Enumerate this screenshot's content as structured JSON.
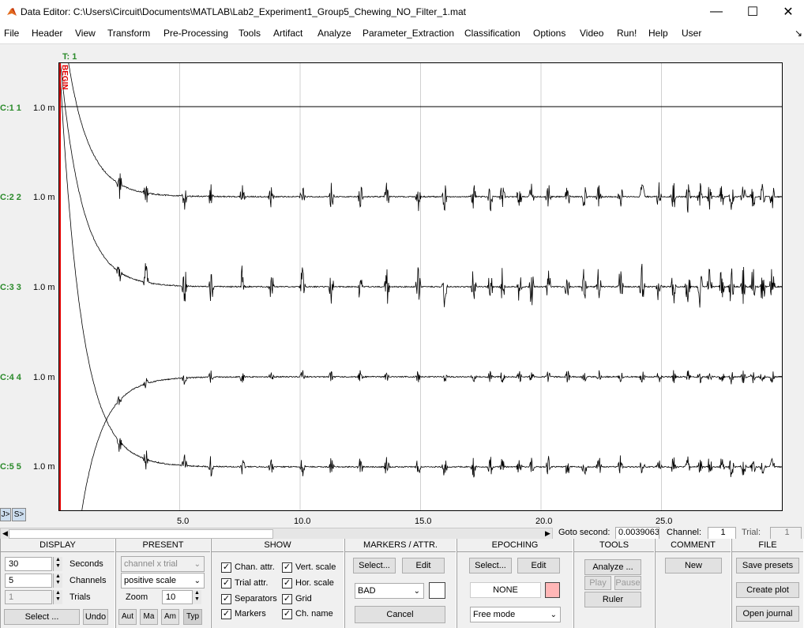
{
  "window": {
    "title": "Data Editor: C:\\Users\\Circuit\\Documents\\MATLAB\\Lab2_Experiment1_Group5_Chewing_NO_Filter_1.mat",
    "minimize": "—",
    "maximize": "☐",
    "close": "✕"
  },
  "menu": [
    "File",
    "Header",
    "View",
    "Transform",
    "Pre-Processing",
    "Tools",
    "Artifact",
    "Analyze",
    "Parameter_Extraction",
    "Classification",
    "Options",
    "Video",
    "Run!",
    "Help",
    "User"
  ],
  "menu_right_glyph": "↘",
  "plot": {
    "trial_label": "T: 1",
    "begin_marker": "BEGIN",
    "channels": [
      {
        "label": "C:1 1",
        "scale": "1.0 m"
      },
      {
        "label": "C:2 2",
        "scale": "1.0 m"
      },
      {
        "label": "C:3 3",
        "scale": "1.0 m"
      },
      {
        "label": "C:4 4",
        "scale": "1.0 m"
      },
      {
        "label": "C:5 5",
        "scale": "1.0 m"
      }
    ],
    "x_ticks": [
      "5.0",
      "10.0",
      "15.0",
      "20.0",
      "25.0"
    ],
    "colors": {
      "marker": "#e00000",
      "label": "#2a8a2a",
      "trace": "#000000"
    }
  },
  "chart_data": {
    "type": "line",
    "title": "",
    "xlabel": "",
    "ylabel": "",
    "xlim": [
      0,
      30
    ],
    "x_ticks": [
      5,
      10,
      15,
      20,
      25
    ],
    "series": [
      {
        "name": "C:1 1",
        "description_values": "flat baseline"
      },
      {
        "name": "C:2 2"
      },
      {
        "name": "C:3 3"
      },
      {
        "name": "C:4 4"
      },
      {
        "name": "C:5 5"
      }
    ],
    "grid": true
  },
  "nav": {
    "left_btn": "J>",
    "right_btn": "S>",
    "goto_label": "Goto second:",
    "goto_value": "0.0039063",
    "channel_label": "Channel:",
    "channel_value": "1",
    "trial_label": "Trial:",
    "trial_value": "1"
  },
  "display": {
    "header": "DISPLAY",
    "seconds_value": "30",
    "seconds_label": "Seconds",
    "channels_value": "5",
    "channels_label": "Channels",
    "trials_value": "1",
    "trials_label": "Trials",
    "select_btn": "Select ...",
    "undo_btn": "Undo"
  },
  "present": {
    "header": "PRESENT",
    "mode": "channel x trial",
    "scale": "positive scale",
    "zoom_label": "Zoom",
    "zoom_value": "10",
    "buttons": [
      "Aut",
      "Ma",
      "Am",
      "Typ"
    ]
  },
  "show": {
    "header": "SHOW",
    "items": [
      {
        "label": "Chan. attr.",
        "checked": true
      },
      {
        "label": "Trial attr.",
        "checked": true
      },
      {
        "label": "Separators",
        "checked": true
      },
      {
        "label": "Markers",
        "checked": true
      },
      {
        "label": "Vert. scale",
        "checked": true
      },
      {
        "label": "Hor. scale",
        "checked": true
      },
      {
        "label": "Grid",
        "checked": true
      },
      {
        "label": "Ch. name",
        "checked": true
      }
    ]
  },
  "markers": {
    "header": "MARKERS / ATTR.",
    "select_btn": "Select...",
    "edit_btn": "Edit",
    "type_value": "BAD",
    "cancel_btn": "Cancel",
    "swatch_color": "#ffffff"
  },
  "epoching": {
    "header": "EPOCHING",
    "select_btn": "Select...",
    "edit_btn": "Edit",
    "none_label": "NONE",
    "swatch_color": "#ffb6b6",
    "mode_value": "Free mode"
  },
  "tools": {
    "header": "TOOLS",
    "analyze_btn": "Analyze ...",
    "play_btn": "Play",
    "pause_btn": "Pause",
    "ruler_btn": "Ruler"
  },
  "comment": {
    "header": "COMMENT",
    "new_btn": "New"
  },
  "file": {
    "header": "FILE",
    "save_btn": "Save presets",
    "plot_btn": "Create plot",
    "journal_btn": "Open journal"
  }
}
